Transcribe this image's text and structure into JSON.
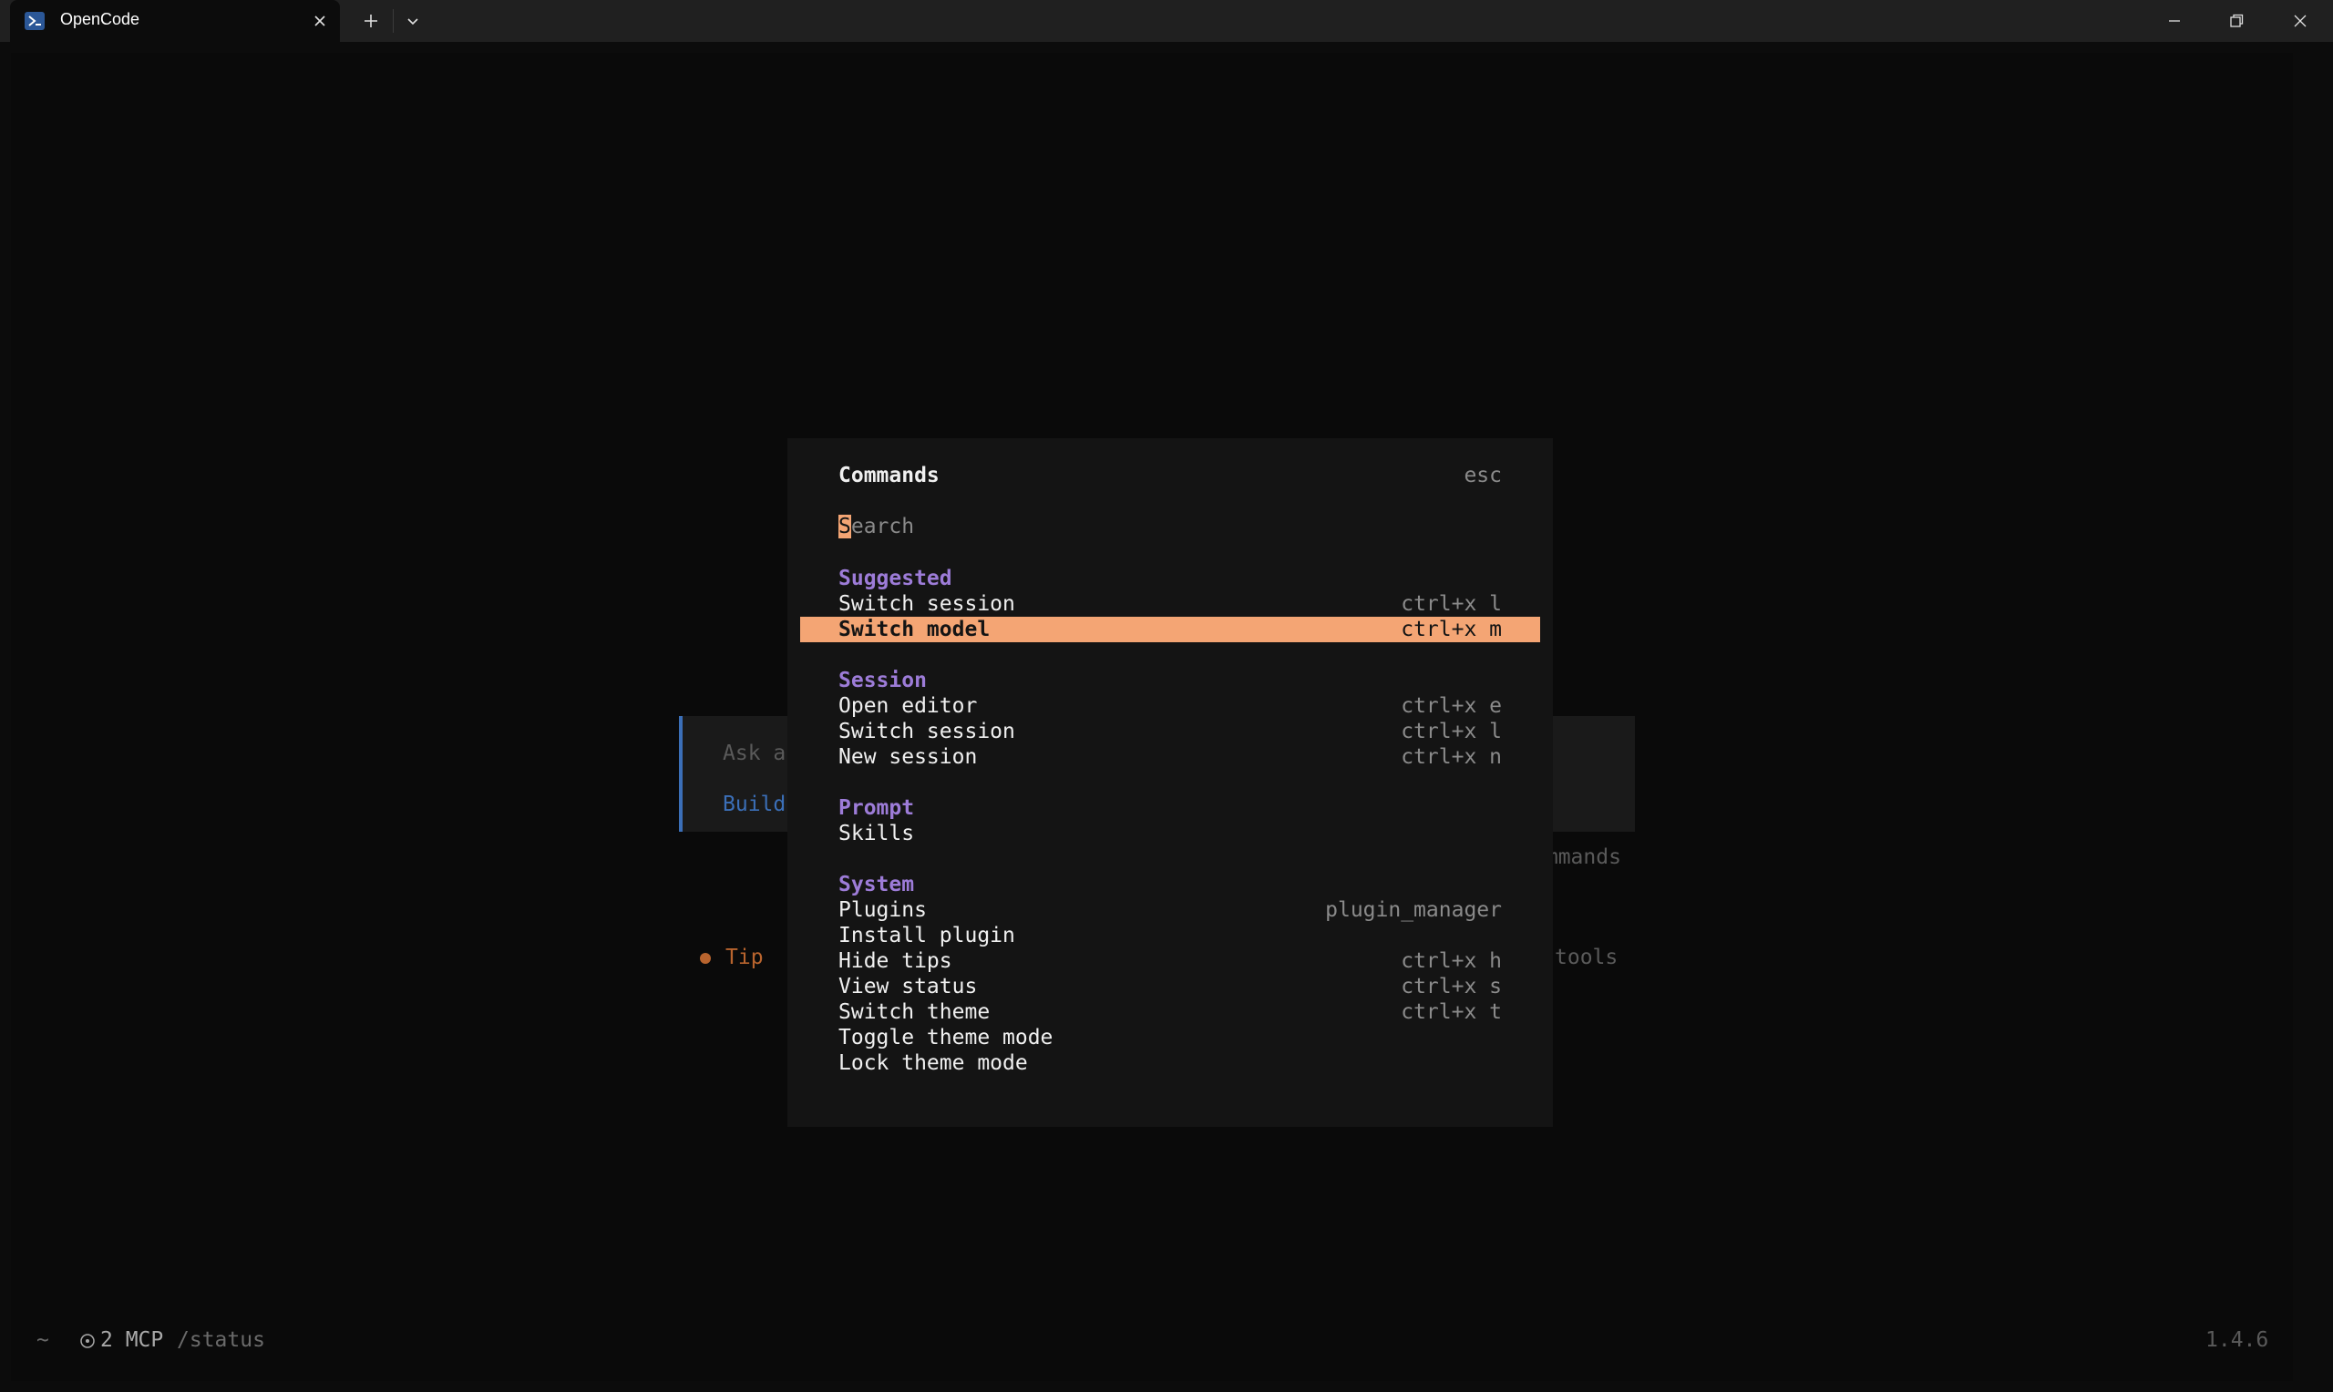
{
  "window": {
    "tab_title": "OpenCode",
    "icons": {
      "tab": "powershell-icon",
      "close_tab": "close-icon",
      "new_tab": "plus-icon",
      "dropdown": "chevron-down-icon",
      "minimize": "minimize-icon",
      "maximize": "restore-icon",
      "close": "close-icon"
    }
  },
  "background": {
    "prompt_placeholder": "Ask a",
    "prompt_agent": "Build",
    "commands_hint": "ommands",
    "tip_label": "Tip",
    "tip_tail": "tools"
  },
  "status": {
    "home": "~",
    "mcp_count": "2 MCP",
    "mcp_command": "/status",
    "version": "1.4.6"
  },
  "palette": {
    "title": "Commands",
    "close_hint": "esc",
    "search_placeholder": "Search",
    "search_cursor": "S",
    "search_rest": "earch",
    "groups": [
      {
        "title": "Suggested",
        "items": [
          {
            "label": "Switch session",
            "key": "ctrl+x l"
          },
          {
            "label": "Switch model",
            "key": "ctrl+x m",
            "selected": true
          }
        ]
      },
      {
        "title": "Session",
        "items": [
          {
            "label": "Open editor",
            "key": "ctrl+x e"
          },
          {
            "label": "Switch session",
            "key": "ctrl+x l"
          },
          {
            "label": "New session",
            "key": "ctrl+x n"
          }
        ]
      },
      {
        "title": "Prompt",
        "items": [
          {
            "label": "Skills",
            "key": ""
          }
        ]
      },
      {
        "title": "System",
        "items": [
          {
            "label": "Plugins",
            "key": "plugin_manager"
          },
          {
            "label": "Install plugin",
            "key": ""
          },
          {
            "label": "Hide tips",
            "key": "ctrl+x h"
          },
          {
            "label": "View status",
            "key": "ctrl+x s"
          },
          {
            "label": "Switch theme",
            "key": "ctrl+x t"
          },
          {
            "label": "Toggle theme mode",
            "key": ""
          },
          {
            "label": "Lock theme mode",
            "key": ""
          }
        ]
      }
    ]
  },
  "colors": {
    "accent": "#f4a574",
    "group_heading": "#9d7cd8",
    "agent": "#3b6fb8",
    "tip": "#b8642e"
  }
}
